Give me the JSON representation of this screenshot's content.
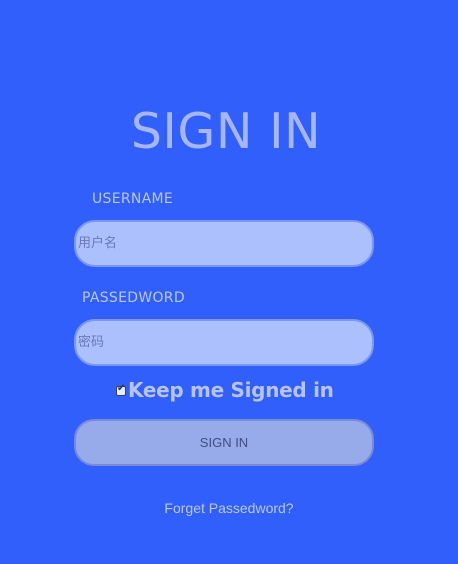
{
  "colors": {
    "background": "#315ffb",
    "title": "#a7b6f8",
    "input_fill": "#adc0fe",
    "button_fill": "#97aae9"
  },
  "form": {
    "title": "SIGN IN",
    "username": {
      "label": "USERNAME",
      "placeholder": "用户名",
      "value": ""
    },
    "password": {
      "label": "PASSEDWORD",
      "placeholder": "密码",
      "value": ""
    },
    "remember": {
      "label": "Keep me Signed in",
      "checked": true
    },
    "submit_label": "SIGN IN",
    "forgot_label": "Forget Passedword?"
  }
}
